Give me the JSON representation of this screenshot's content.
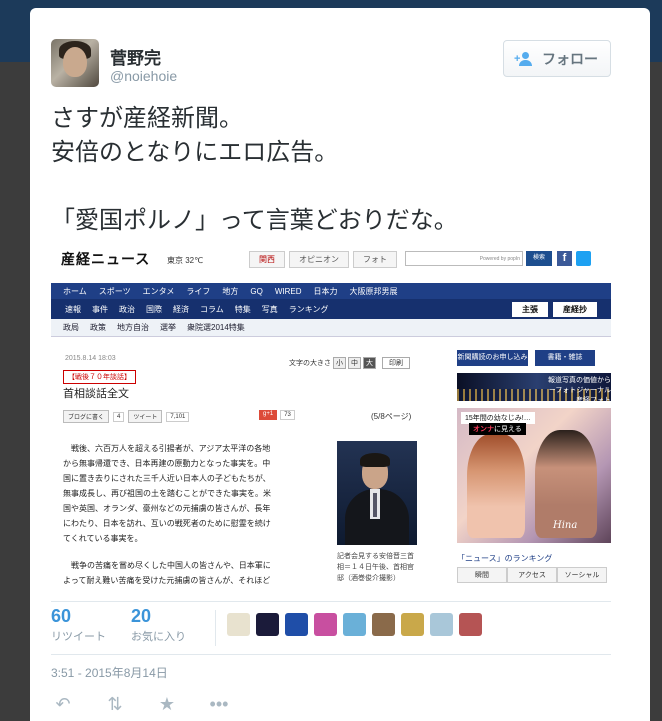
{
  "user": {
    "name": "菅野完",
    "handle": "@noiehoie"
  },
  "follow_button": {
    "label": "フォロー"
  },
  "tweet": {
    "text": "さすが産経新聞。\n安倍のとなりにエロ広告。\n\n「愛国ポルノ」って言葉どおりだな。"
  },
  "embedded": {
    "logo": "産経ニュース",
    "weather": "東京 32℃",
    "tabs": [
      "関西",
      "オピニオン",
      "フォト"
    ],
    "search_hint": "Powered by popIn",
    "search_button": "検索",
    "nav1": [
      "ホーム",
      "スポーツ",
      "エンタメ",
      "ライフ",
      "地方",
      "GQ",
      "WIRED",
      "日本力",
      "大阪原邦男展"
    ],
    "nav2": [
      "速報",
      "事件",
      "政治",
      "国際",
      "経済",
      "コラム",
      "特集",
      "写真",
      "ランキング"
    ],
    "nav2_right": [
      "主張",
      "産経抄"
    ],
    "nav3": [
      "政局",
      "政策",
      "地方自治",
      "選挙",
      "衆院選2014特集"
    ],
    "date": "2015.8.14 18:03",
    "font_size_label": "文字の大きさ",
    "font_sizes": [
      "小",
      "中",
      "大"
    ],
    "print_label": "印刷",
    "category": "【戦後７０年談話】",
    "title": "首相談話全文",
    "social": {
      "blog": "ブログに書く",
      "blog_count": "4",
      "tweet": "ツイート",
      "tweet_count": "7,101",
      "gplus": "g+1",
      "gplus_count": "73"
    },
    "pages": "(5/8ページ)",
    "body1": "　戦後、六百万人を超える引揚者が、アジア太平洋の各地\nから無事帰還でき、日本再建の原動力となった事実を。中\n国に置き去りにされた三千人近い日本人の子どもたちが、\n無事成長し、再び祖国の土を踏むことができた事実を。米\n国や英国、オランダ、豪州などの元捕虜の皆さんが、長年\nにわたり、日本を訪れ、互いの戦死者のために慰霊を続け\nてくれている事実を。",
    "body2": "　戦争の苦痛を嘗め尽くした中国人の皆さんや、日本軍に\nよって耐え難い苦痛を受けた元捕虜の皆さんが、それほど",
    "caption": "記者会見する安倍晋三首相＝１４日午後、首相官邸（酒巻俊介撮影）",
    "right_buttons": [
      "新聞購読のお申し込み",
      "書籍・雑誌"
    ],
    "banner_text": "報道写真の価値から\nーフォトジャーナル\n産経フォト",
    "ad_tag": "15年間の幼なじみ!…",
    "ad_tag2_prefix": "オンナ",
    "ad_tag2_suffix": "に見える",
    "ad_sig": "Hina",
    "ranking_title": "「ニュース」のランキング",
    "ranking_tabs": [
      "瞬間",
      "アクセス",
      "ソーシャル"
    ]
  },
  "stats": {
    "retweets": "60",
    "retweets_label": "リツイート",
    "favorites": "20",
    "favorites_label": "お気に入り"
  },
  "favoriters": [
    {
      "icon": "panda-avatar",
      "color": "#e8e2cf"
    },
    {
      "icon": "dark-avatar",
      "color": "#1b1b3a"
    },
    {
      "icon": "chelsea-avatar",
      "color": "#1f4ea8"
    },
    {
      "icon": "pink-avatar",
      "color": "#c84fa0"
    },
    {
      "icon": "pattern-avatar",
      "color": "#6ab0d8"
    },
    {
      "icon": "person-avatar",
      "color": "#8a6a4a"
    },
    {
      "icon": "anime-avatar",
      "color": "#c9a84a"
    },
    {
      "icon": "beach-avatar",
      "color": "#a9c7d9"
    },
    {
      "icon": "red-avatar",
      "color": "#b55454"
    }
  ],
  "timestamp": "3:51 - 2015年8月14日",
  "actions": [
    "reply-icon",
    "retweet-icon",
    "favorite-icon",
    "more-icon"
  ]
}
